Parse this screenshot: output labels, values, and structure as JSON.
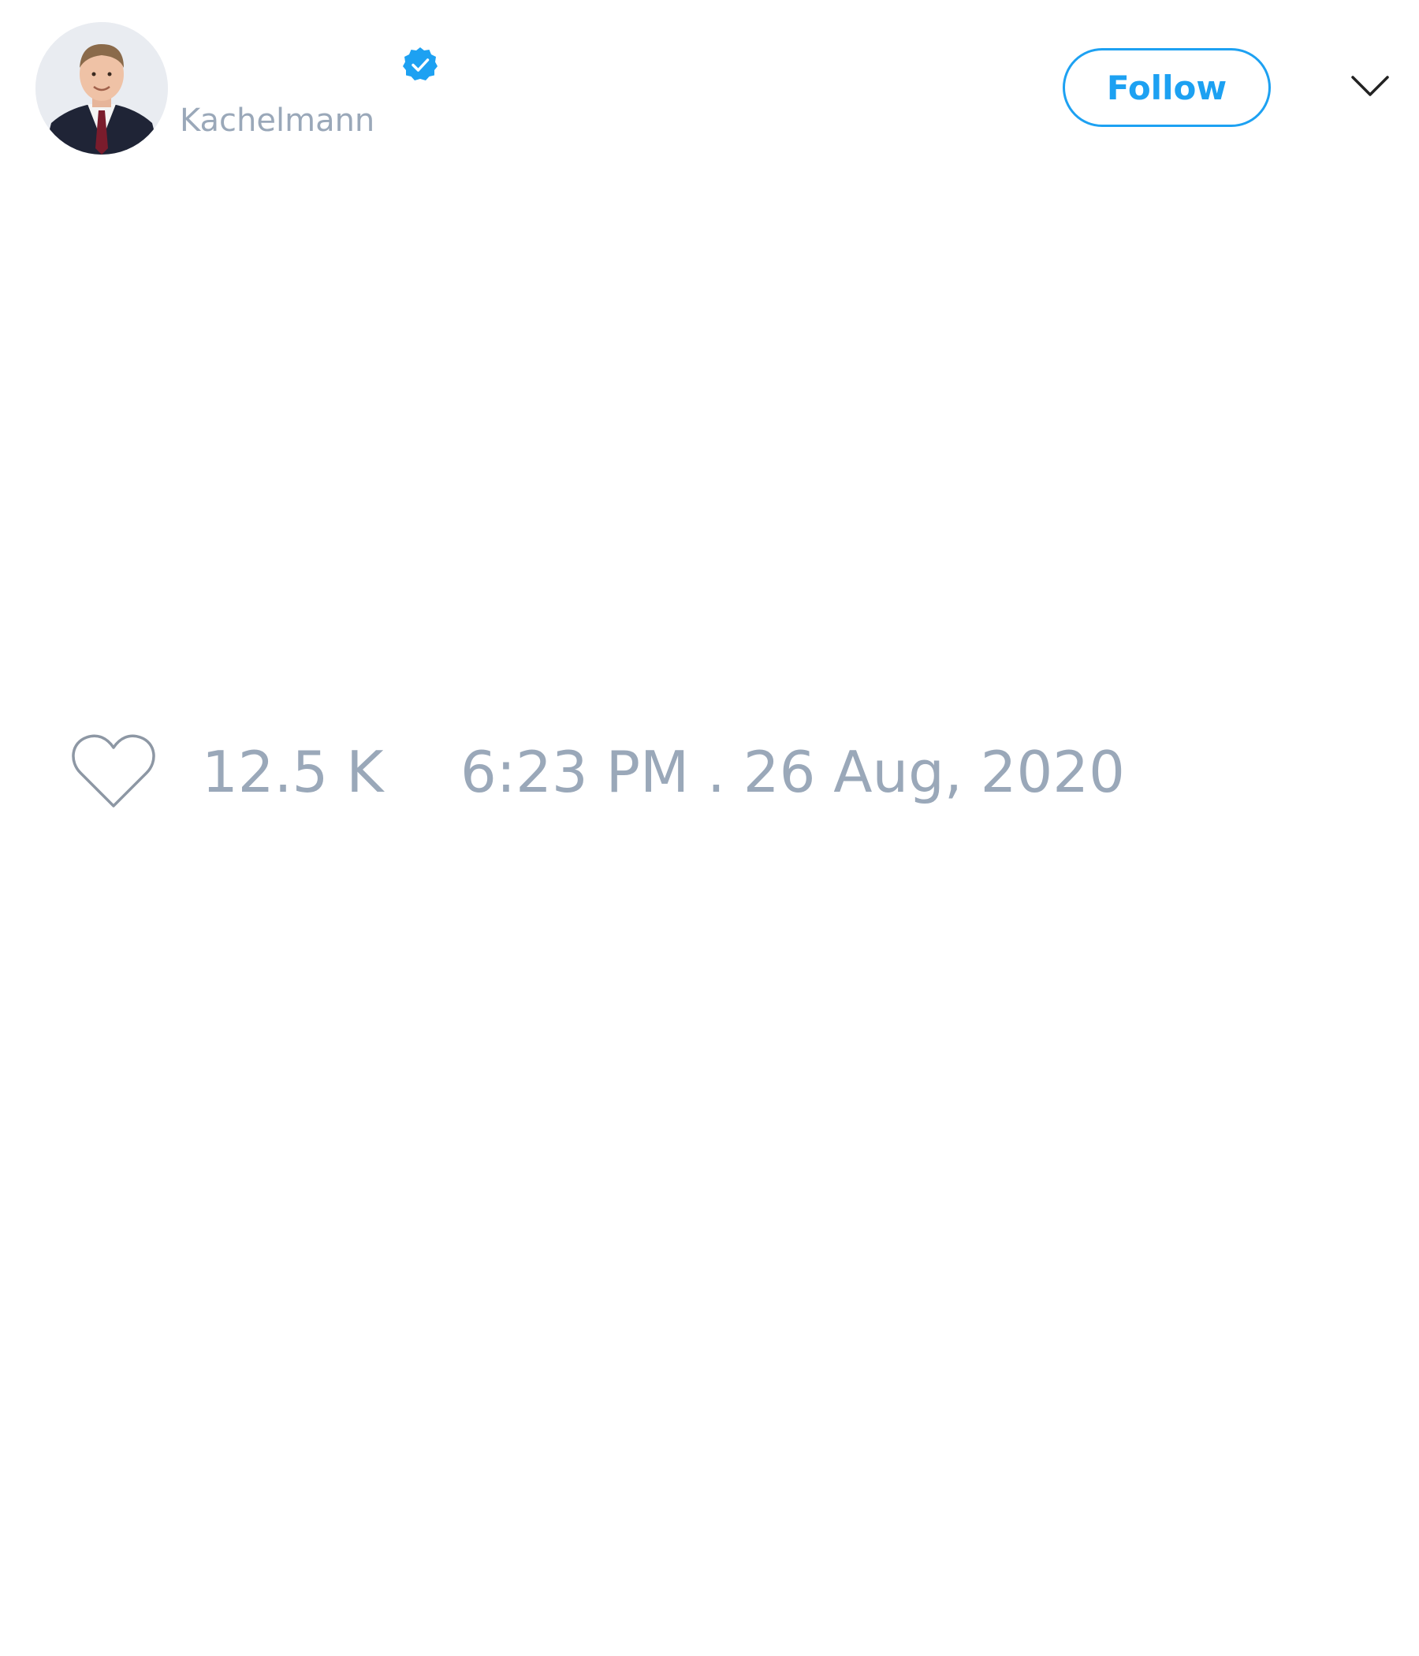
{
  "author": {
    "handle": "Kachelmann",
    "verified": true,
    "avatar": "avatar-photo"
  },
  "actions": {
    "follow_label": "Follow",
    "menu_icon": "chevron-down-icon"
  },
  "stats": {
    "like_icon": "heart-icon",
    "like_count": "12.5 K"
  },
  "tweet": {
    "timestamp": "6:23 PM . 26 Aug, 2020"
  },
  "colors": {
    "accent": "#1da1f2",
    "muted_text": "#9aa8b9",
    "background": "#ffffff"
  }
}
